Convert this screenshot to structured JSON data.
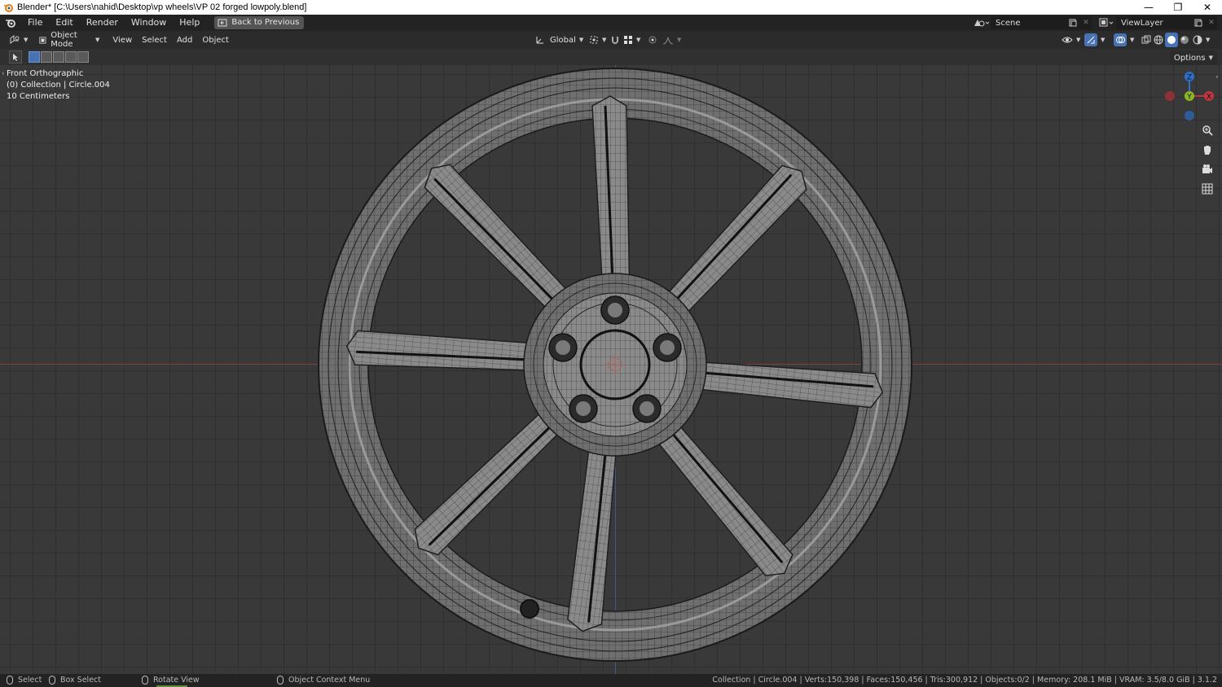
{
  "window": {
    "title": "Blender* [C:\\Users\\nahid\\Desktop\\vp wheels\\VP 02 forged lowpoly.blend]",
    "controls": [
      "—",
      "❐",
      "✕"
    ]
  },
  "topbar": {
    "menus": [
      "File",
      "Edit",
      "Render",
      "Window",
      "Help"
    ],
    "back_label": "Back to Previous",
    "scene": "Scene",
    "view_layer": "ViewLayer"
  },
  "header": {
    "mode": "Object Mode",
    "menus": [
      "View",
      "Select",
      "Add",
      "Object"
    ],
    "transform_orientation": "Global",
    "options": "Options"
  },
  "viewport": {
    "view_name": "Front Orthographic",
    "collection": "(0) Collection | Circle.004",
    "scale": "10 Centimeters",
    "gizmo": {
      "z": "Z",
      "y": "Y",
      "x": "X"
    },
    "colors": {
      "x_axis": "#c1353f",
      "y_axis": "#8bb726",
      "z_axis": "#2d6fc9"
    }
  },
  "statusbar": {
    "select": "Select",
    "box_select": "Box Select",
    "rotate_view": "Rotate View",
    "context_menu": "Object Context Menu",
    "stats": "Collection | Circle.004 | Verts:150,398 | Faces:150,456 | Tris:300,912 | Objects:0/2 | Memory: 208.1 MiB | VRAM: 3.5/8.0 GiB | 3.1.2"
  }
}
